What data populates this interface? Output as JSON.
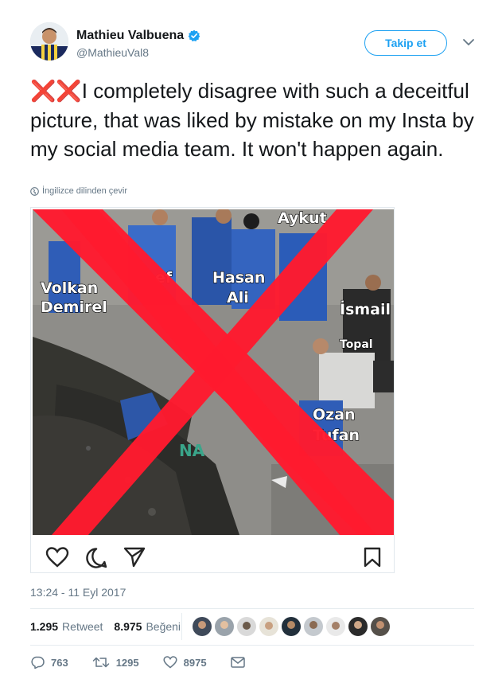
{
  "tweet": {
    "author_name": "Mathieu Valbuena",
    "handle": "@MathieuVal8",
    "follow_label": "Takip et",
    "text_emoji": "❌❌",
    "text": "I completely disagree with such a deceitful picture, that was liked by mistake on my Insta by my social media team. It won't happen again.",
    "translate_label": "İngilizce dilinden çevir",
    "timestamp": "13:24 - 11 Eyl 2017",
    "retweets_count": "1.295",
    "retweets_label": "Retweet",
    "likes_count": "8.975",
    "likes_label": "Beğeni"
  },
  "media": {
    "overlay_labels": {
      "volkan": "Volkan",
      "demirel": "Demirel",
      "sef": "ef",
      "hasan": "Hasan",
      "ali": "Ali",
      "aykut": "Aykut",
      "ismail": "İsmail",
      "topal": "Topal",
      "ozan": "Ozan",
      "tufan": "Tufan",
      "na": "NA"
    }
  },
  "actions": {
    "reply_count": "763",
    "retweet_count": "1295",
    "like_count": "8975"
  },
  "colors": {
    "accent": "#1da1f2",
    "cross": "#ff1a2e",
    "verified": "#1da1f2"
  }
}
